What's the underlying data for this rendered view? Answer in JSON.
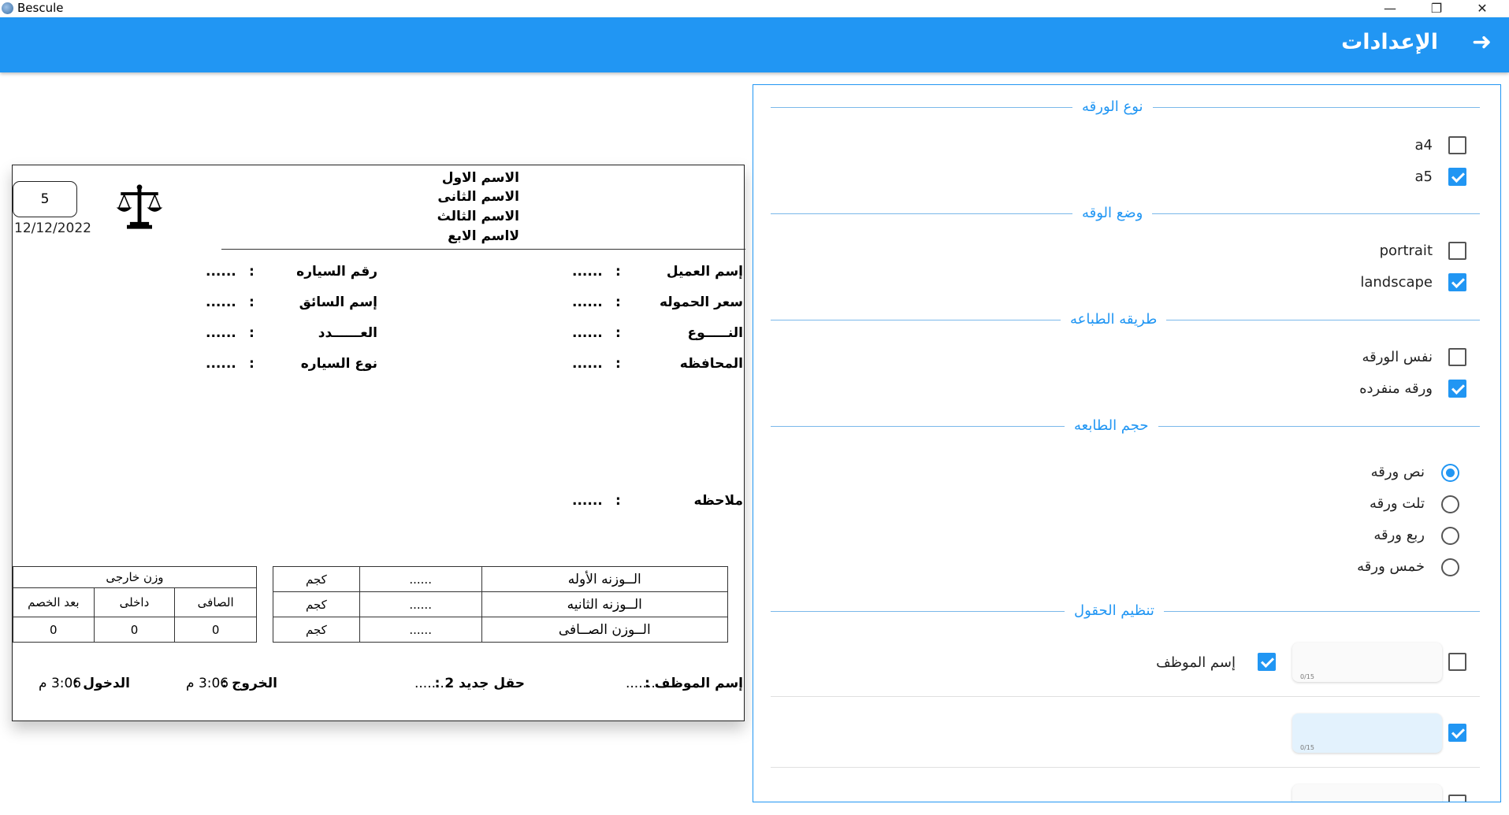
{
  "window": {
    "title": "Bescule",
    "minimize": "—",
    "restore": "❐",
    "close": "✕"
  },
  "header": {
    "title": "الإعدادات",
    "back_icon": "arrow-right-icon",
    "color": "#2196f3"
  },
  "preview": {
    "count": "5",
    "date": "12/12/2022",
    "names": [
      "الاسم الاول",
      "الاسم الثانى",
      "الاسم الثالث",
      "لااسم الابع"
    ],
    "left_fields": [
      {
        "label": "إسم العميل",
        "sep": ":",
        "value": "......"
      },
      {
        "label": "سعر الحموله",
        "sep": ":",
        "value": "......"
      },
      {
        "label": "النـــــوع",
        "sep": ":",
        "value": "......"
      },
      {
        "label": "المحافظه",
        "sep": ":",
        "value": "......"
      }
    ],
    "right_fields": [
      {
        "label": "رقم السياره",
        "sep": ":",
        "value": "......"
      },
      {
        "label": "إسم السائق",
        "sep": ":",
        "value": "......"
      },
      {
        "label": "العــــــدد",
        "sep": ":",
        "value": "......"
      },
      {
        "label": "نوع السياره",
        "sep": ":",
        "value": "......"
      }
    ],
    "note": {
      "label": "ملاحظه",
      "sep": ":",
      "value": "......"
    },
    "weights": [
      {
        "label": "الــوزنه الأوله",
        "value": "......",
        "unit": "كجم"
      },
      {
        "label": "الــوزنه الثانيه",
        "value": "......",
        "unit": "كجم"
      },
      {
        "label": "الــوزن الصــافى",
        "value": "......",
        "unit": "كجم"
      }
    ],
    "external": {
      "title": "وزن خارجى",
      "headers": [
        "الصافى",
        "داخلى",
        "بعد الخصم"
      ],
      "values": [
        "0",
        "0",
        "0"
      ]
    },
    "footer": {
      "employee_label": "إسم الموظف :",
      "employee_value": "........",
      "new_field_label": "حقل جديد 2 :",
      "new_field_value": "........",
      "exit_label": "الخروج :",
      "exit_value": "3:06 م",
      "entry_label": "الدخول :",
      "entry_value": "3:06 م"
    }
  },
  "settings": {
    "paper_type": {
      "title": "نوع الورقه",
      "options": [
        {
          "label": "a4",
          "checked": false
        },
        {
          "label": "a5",
          "checked": true
        }
      ]
    },
    "orientation": {
      "title": "وضع الوقه",
      "options": [
        {
          "label": "portrait",
          "checked": false
        },
        {
          "label": "landscape",
          "checked": true
        }
      ]
    },
    "print_method": {
      "title": "طريقه الطباعه",
      "options": [
        {
          "label": "نفس الورقه",
          "checked": false
        },
        {
          "label": "ورقه منفرده",
          "checked": true
        }
      ]
    },
    "print_size": {
      "title": "حجم الطابعه",
      "options": [
        {
          "label": "نص ورقه",
          "selected": true
        },
        {
          "label": "تلت ورقه",
          "selected": false
        },
        {
          "label": "ربع ورقه",
          "selected": false
        },
        {
          "label": "خمس ورقه",
          "selected": false
        }
      ]
    },
    "fields": {
      "title": "تنظيم الحقول",
      "rows": [
        {
          "field_label": "إسم الموظف",
          "field_checked": true,
          "box_counter": "0/15",
          "row_checked": false
        },
        {
          "field_label": "",
          "field_checked": false,
          "box_counter": "0/15",
          "row_checked": true
        }
      ]
    }
  }
}
